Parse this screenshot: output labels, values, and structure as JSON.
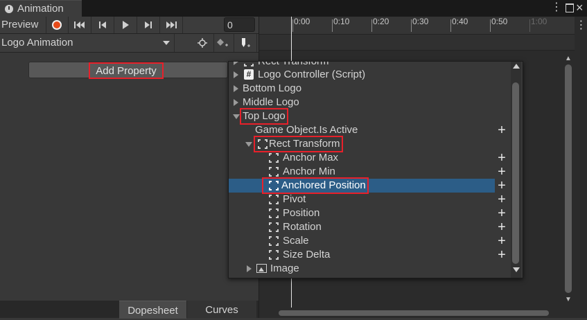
{
  "window": {
    "tab_title": "Animation"
  },
  "toolbar": {
    "preview_label": "Preview",
    "frame_value": "0"
  },
  "clip": {
    "selected": "Logo Animation"
  },
  "add_property": {
    "label": "Add Property"
  },
  "bottom_tabs": {
    "dopesheet": "Dopesheet",
    "curves": "Curves"
  },
  "timeline": {
    "ticks": [
      "0:00",
      "0:10",
      "0:20",
      "0:30",
      "0:40",
      "0:50",
      "1:00"
    ]
  },
  "tree": {
    "items": [
      {
        "label": "Rect Transform",
        "icon": "rect-transform-icon"
      },
      {
        "label": "Logo Controller (Script)",
        "icon": "script-icon"
      },
      {
        "label": "Bottom Logo"
      },
      {
        "label": "Middle Logo"
      },
      {
        "label": "Top Logo"
      },
      {
        "label": "Game Object.Is Active"
      },
      {
        "label": "Rect Transform",
        "icon": "rect-transform-icon"
      },
      {
        "label": "Anchor Max",
        "icon": "rect-transform-icon"
      },
      {
        "label": "Anchor Min",
        "icon": "rect-transform-icon"
      },
      {
        "label": "Anchored Position",
        "icon": "rect-transform-icon"
      },
      {
        "label": "Pivot",
        "icon": "rect-transform-icon"
      },
      {
        "label": "Position",
        "icon": "rect-transform-icon"
      },
      {
        "label": "Rotation",
        "icon": "rect-transform-icon"
      },
      {
        "label": "Scale",
        "icon": "rect-transform-icon"
      },
      {
        "label": "Size Delta",
        "icon": "rect-transform-icon"
      },
      {
        "label": "Image",
        "icon": "image-icon"
      }
    ]
  },
  "colors": {
    "selection": "#2c5d87",
    "highlight_box": "#e8202a",
    "record": "#e64a19"
  }
}
